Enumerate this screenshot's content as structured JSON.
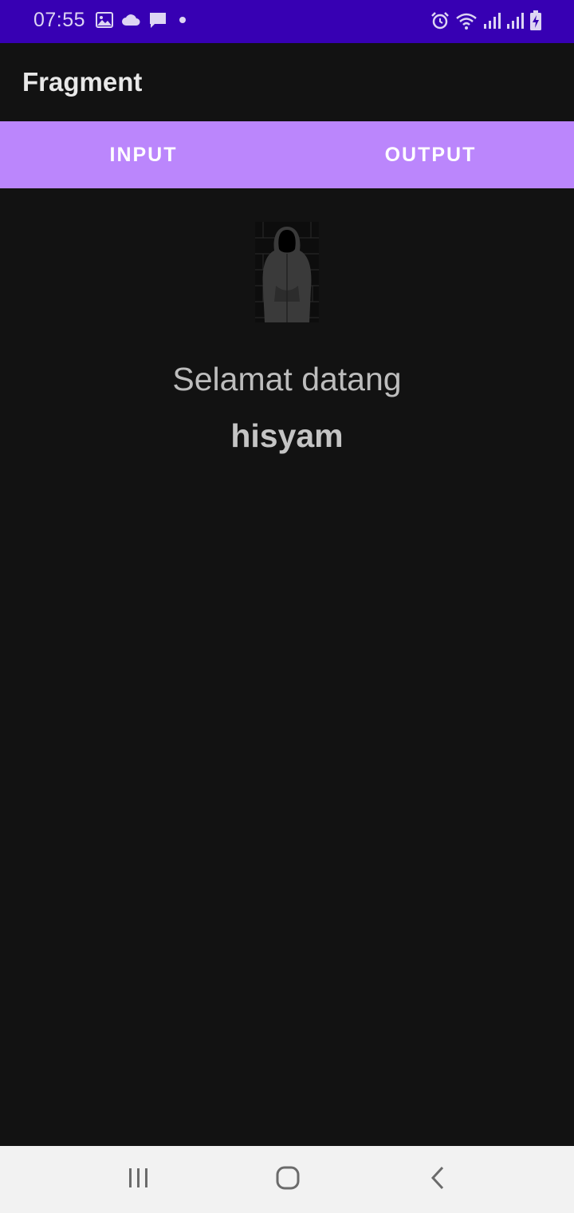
{
  "status_bar": {
    "time": "07:55",
    "left_icons": [
      "image-icon",
      "cloud-icon",
      "message-icon",
      "dot-icon"
    ],
    "right_icons": [
      "alarm-icon",
      "wifi-icon",
      "signal-icon",
      "signal-icon",
      "battery-charging-icon"
    ]
  },
  "app_bar": {
    "title": "Fragment"
  },
  "tabs": [
    {
      "label": "INPUT"
    },
    {
      "label": "OUTPUT"
    }
  ],
  "content": {
    "avatar_icon": "hooded-figure-image",
    "welcome": "Selamat datang",
    "name": "hisyam"
  },
  "nav_bar": {
    "buttons": [
      "recents-icon",
      "home-icon",
      "back-icon"
    ]
  },
  "colors": {
    "status_bar": "#3700b3",
    "background": "#121212",
    "tab_bar": "#bb86fc",
    "nav_bar": "#f2f2f2"
  }
}
